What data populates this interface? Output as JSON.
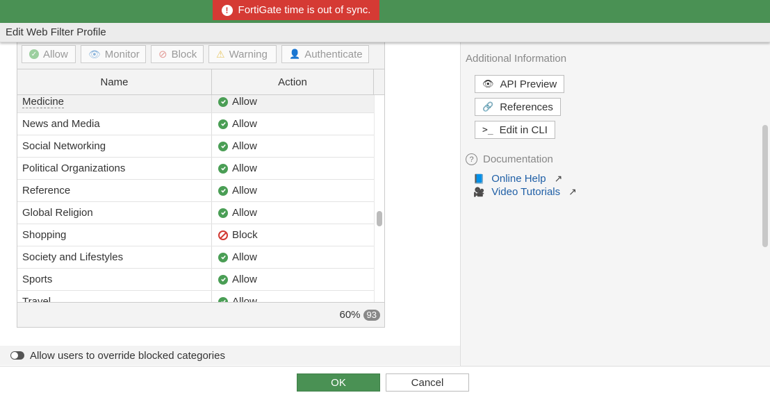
{
  "alert": {
    "text": "FortiGate time is out of sync.",
    "icon": "exclamation-icon"
  },
  "title": "Edit Web Filter Profile",
  "filters": [
    {
      "label": "Allow",
      "icon": "check-circle-icon",
      "color": "#9ccf9f"
    },
    {
      "label": "Monitor",
      "icon": "eye-icon",
      "color": "#8db6dd"
    },
    {
      "label": "Block",
      "icon": "block-icon",
      "color": "#e39c98"
    },
    {
      "label": "Warning",
      "icon": "warning-icon",
      "color": "#e8c96a"
    },
    {
      "label": "Authenticate",
      "icon": "user-icon",
      "color": "#a9c4e4"
    }
  ],
  "table": {
    "columns": [
      "Name",
      "Action"
    ],
    "rows": [
      {
        "name": "Medicine",
        "action": "Allow"
      },
      {
        "name": "News and Media",
        "action": "Allow"
      },
      {
        "name": "Social Networking",
        "action": "Allow"
      },
      {
        "name": "Political Organizations",
        "action": "Allow"
      },
      {
        "name": "Reference",
        "action": "Allow"
      },
      {
        "name": "Global Religion",
        "action": "Allow"
      },
      {
        "name": "Shopping",
        "action": "Block"
      },
      {
        "name": "Society and Lifestyles",
        "action": "Allow"
      },
      {
        "name": "Sports",
        "action": "Allow"
      },
      {
        "name": "Travel",
        "action": "Allow"
      }
    ],
    "footer_percent": "60%",
    "footer_count": "93"
  },
  "override": {
    "label": "Allow users to override blocked categories",
    "enabled": false
  },
  "sidebar": {
    "heading": "Additional Information",
    "buttons": [
      {
        "label": "API Preview",
        "icon": "eye-icon"
      },
      {
        "label": "References",
        "icon": "link-icon"
      },
      {
        "label": "Edit in CLI",
        "icon": "terminal-icon"
      }
    ],
    "doc_heading": "Documentation",
    "links": [
      {
        "label": "Online Help",
        "icon": "book-icon"
      },
      {
        "label": "Video Tutorials",
        "icon": "video-icon"
      }
    ]
  },
  "footer": {
    "ok": "OK",
    "cancel": "Cancel"
  },
  "colors": {
    "header_green": "#4a9154",
    "alert_red": "#d53a34",
    "allow_green": "#4a9e55",
    "block_red": "#d23a33",
    "link_blue": "#1f5fa6"
  }
}
